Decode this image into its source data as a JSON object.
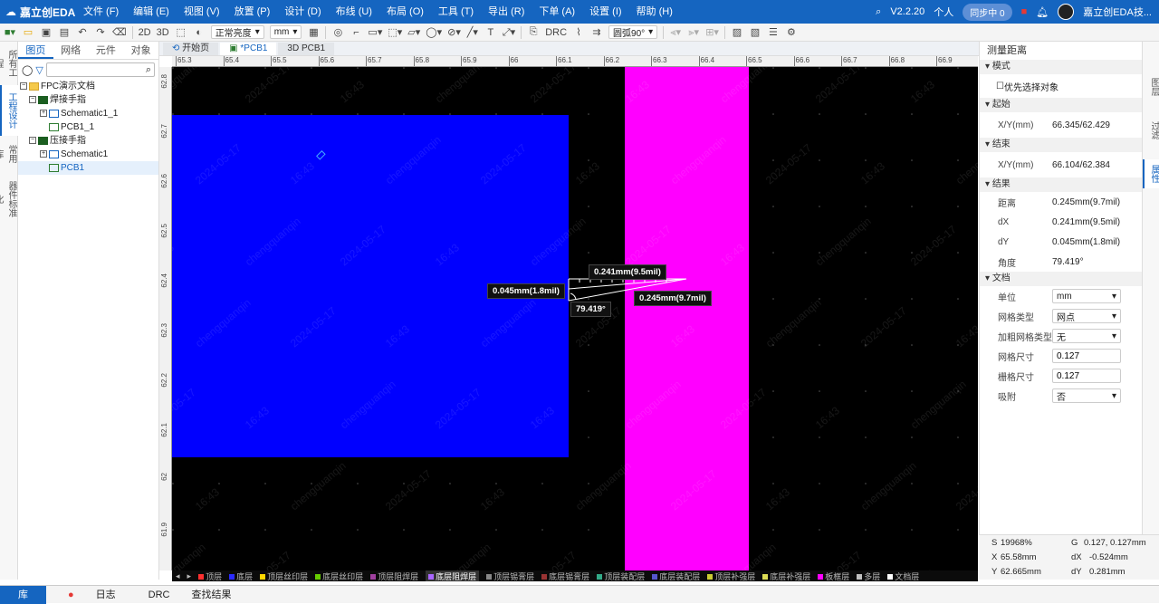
{
  "app": {
    "logo_text": "嘉立创EDA",
    "version": "V2.2.20",
    "account": "个人",
    "sync_label": "同步中 0",
    "user_name": "嘉立创EDA技..."
  },
  "menu": [
    "文件 (F)",
    "编辑 (E)",
    "视图 (V)",
    "放置 (P)",
    "设计 (D)",
    "布线 (U)",
    "布局 (O)",
    "工具 (T)",
    "导出 (R)",
    "下单 (A)",
    "设置 (I)",
    "帮助 (H)"
  ],
  "toolbar": {
    "view2d": "2D",
    "view3d": "3D",
    "brightness": "正常亮度",
    "unit": "mm",
    "arc_mode": "圆弧90°",
    "drc": "DRC"
  },
  "left_tabs": [
    "所有工程",
    "工程设计",
    "常用库",
    "器件标准化"
  ],
  "panel_tabs": [
    "图页",
    "网络",
    "元件",
    "对象"
  ],
  "tree": [
    {
      "label": "FPC演示文档",
      "level": 0,
      "kind": "folder"
    },
    {
      "label": "焊接手指",
      "level": 1,
      "kind": "board"
    },
    {
      "label": "Schematic1_1",
      "level": 2,
      "kind": "sch"
    },
    {
      "label": "PCB1_1",
      "level": 2,
      "kind": "pcb"
    },
    {
      "label": "压接手指",
      "level": 1,
      "kind": "board"
    },
    {
      "label": "Schematic1",
      "level": 2,
      "kind": "sch"
    },
    {
      "label": "PCB1",
      "level": 2,
      "kind": "pcb"
    }
  ],
  "doc_tabs": [
    "开始页",
    "*PCB1",
    "3D PCB1"
  ],
  "ruler_top": [
    "65.3",
    "65.4",
    "65.5",
    "65.6",
    "65.7",
    "65.8",
    "65.9",
    "66",
    "66.1",
    "66.2",
    "66.3",
    "66.4",
    "66.5",
    "66.6",
    "66.7",
    "66.8",
    "66.9"
  ],
  "ruler_left": [
    "62.8",
    "62.7",
    "62.6",
    "62.5",
    "62.4",
    "62.3",
    "62.2",
    "62.1",
    "62",
    "61.9"
  ],
  "measure": {
    "dx_label": "0.241mm(9.5mil)",
    "dy_label": "0.045mm(1.8mil)",
    "dist_label": "0.245mm(9.7mil)",
    "angle_label": "79.419°"
  },
  "watermark": {
    "user": "chengquanqin",
    "date": "2024-05-17",
    "time": "16:43"
  },
  "layers": [
    {
      "name": "顶层",
      "color": "#ff3030"
    },
    {
      "name": "底层",
      "color": "#2a2aff"
    },
    {
      "name": "顶层丝印层",
      "color": "#ffd700"
    },
    {
      "name": "底层丝印层",
      "color": "#66cc00"
    },
    {
      "name": "顶层阻焊层",
      "color": "#a0409f"
    },
    {
      "name": "底层阻焊层",
      "color": "#aa66ff"
    },
    {
      "name": "顶层锡膏层",
      "color": "#888888"
    },
    {
      "name": "底层锡膏层",
      "color": "#993333"
    },
    {
      "name": "顶层装配层",
      "color": "#33aa88"
    },
    {
      "name": "底层装配层",
      "color": "#5555cc"
    },
    {
      "name": "顶层补强层",
      "color": "#cccc33"
    },
    {
      "name": "底层补强层",
      "color": "#dddd55"
    },
    {
      "name": "板框层",
      "color": "#ff00ff"
    },
    {
      "name": "多层",
      "color": "#c0c0c0"
    },
    {
      "name": "文档层",
      "color": "#ffffff"
    }
  ],
  "props": {
    "header": "测量距离",
    "mode_section": "模式",
    "prefer_select": "优先选择对象",
    "start_section": "起始",
    "start_key": "X/Y(mm)",
    "start_val": "66.345/62.429",
    "end_section": "结束",
    "end_key": "X/Y(mm)",
    "end_val": "66.104/62.384",
    "result_section": "结果",
    "dist_key": "距离",
    "dist_val": "0.245mm(9.7mil)",
    "dx_key": "dX",
    "dx_val": "0.241mm(9.5mil)",
    "dy_key": "dY",
    "dy_val": "0.045mm(1.8mil)",
    "angle_key": "角度",
    "angle_val": "79.419°",
    "doc_section": "文档",
    "unit_key": "单位",
    "unit_val": "mm",
    "grid_type_key": "网格类型",
    "grid_type_val": "网点",
    "thick_grid_key": "加粗网格类型",
    "thick_grid_val": "无",
    "grid_size_key": "网格尺寸",
    "grid_size_val": "0.127",
    "snap_size_key": "栅格尺寸",
    "snap_size_val": "0.127",
    "snap_key": "吸附",
    "snap_val": "否"
  },
  "right_tabs": [
    "图层",
    "过滤",
    "属性"
  ],
  "status": {
    "s_key": "S",
    "s_val": "19968%",
    "g_key": "G",
    "g_val": "0.127, 0.127mm",
    "x_key": "X",
    "x_val": "65.58mm",
    "dx_key": "dX",
    "dx_val": "-0.524mm",
    "y_key": "Y",
    "y_val": "62.665mm",
    "dy_key": "dY",
    "dy_val": "0.281mm"
  },
  "bottom_tabs": [
    "库",
    "日志",
    "DRC",
    "查找结果"
  ]
}
